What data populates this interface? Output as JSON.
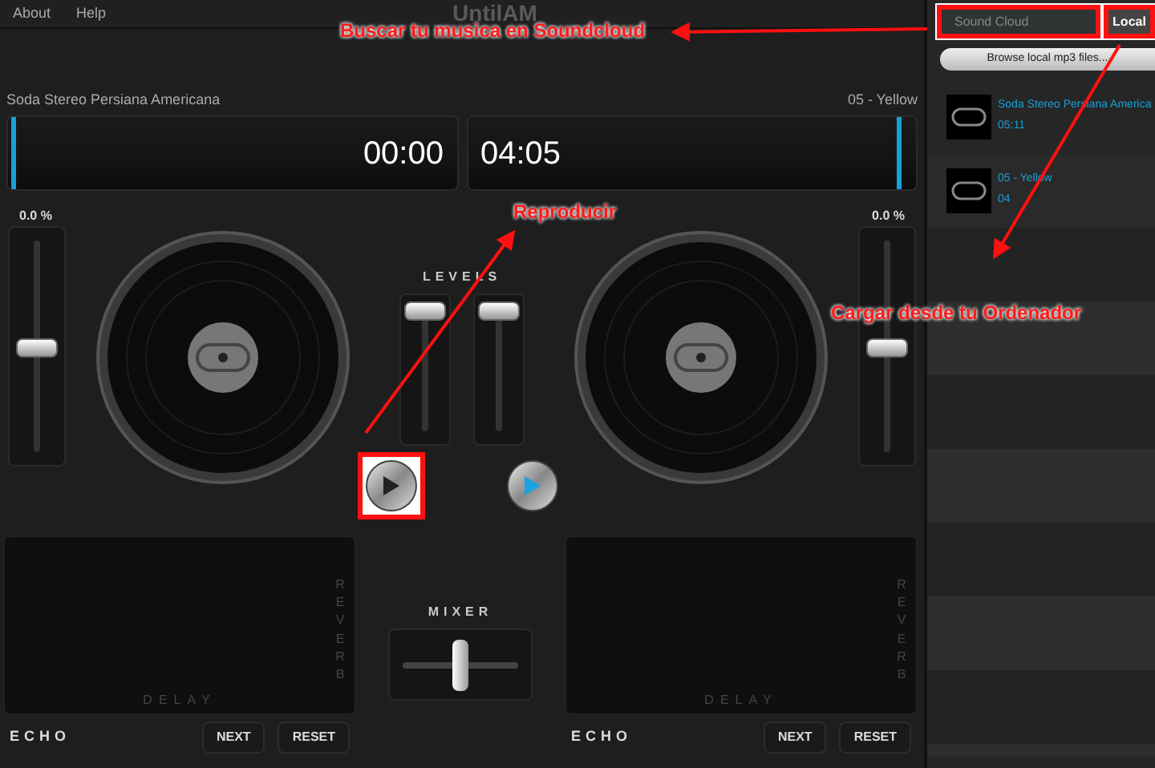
{
  "menu": [
    "About",
    "Help"
  ],
  "logo": "UntilAM",
  "decks": [
    {
      "track": "Soda Stereo  Persiana Americana",
      "time": "00:00",
      "position": {
        "level": 0.0
      },
      "pitch_label": "0.0 %",
      "pitch": {
        "level": 0.5
      },
      "play_button": {
        "highlighted": true,
        "kind": "dark"
      },
      "fx": {
        "side_label": "REVERB",
        "bottom_label": "DELAY",
        "echo_label": "ECHO",
        "buttons": [
          "NEXT",
          "RESET"
        ]
      }
    },
    {
      "track": "05 - Yellow",
      "time": "04:05",
      "position": {
        "level": 0.95
      },
      "pitch_label": "0.0 %",
      "pitch": {
        "level": 0.5
      },
      "play_button": {
        "highlighted": false,
        "kind": "blue"
      },
      "fx": {
        "side_label": "REVERB",
        "bottom_label": "DELAY",
        "echo_label": "ECHO",
        "buttons": [
          "NEXT",
          "RESET"
        ]
      }
    }
  ],
  "levels": {
    "label": "LEVELS",
    "faders": [
      {
        "level": 0.9
      },
      {
        "level": 0.9
      }
    ]
  },
  "mixer": {
    "label": "MIXER",
    "level": 0.5
  },
  "sidebar": {
    "source_field": {
      "value": "Sound Cloud",
      "highlighted": true
    },
    "local_button": {
      "label": "Local",
      "highlighted": true
    },
    "browse_button": "Browse local mp3 files...",
    "tracks": [
      {
        "title": "Soda Stereo  Persiana America",
        "duration": "05:11"
      },
      {
        "title": "05 - Yellow",
        "duration": "04"
      }
    ]
  },
  "annotations": [
    "Buscar tu musica en Soundcloud",
    "Reproducir",
    "Cargar desde tu Ordenador"
  ]
}
